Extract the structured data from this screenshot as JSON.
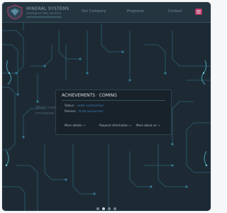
{
  "header": {
    "brand_title": "MINERAL SYSTEMS",
    "brand_subtitle": "Geological data services",
    "nav": [
      "Our Company",
      "Programs",
      "Contact"
    ],
    "menu_icon": "hamburger-icon",
    "logo_icon": "shield-logo-icon"
  },
  "card": {
    "title": "ACHIEVEMENTS · COMING",
    "rows": [
      {
        "label": "Status:",
        "value": "under construction"
      },
      {
        "label": "Release:",
        "value": "to be announced"
      }
    ],
    "links": [
      "More details →",
      "Request information →",
      "More about us →"
    ]
  },
  "background": {
    "ghost_lines": [
      "Where research meets",
      "innovation"
    ]
  },
  "pager": {
    "count": 4,
    "active_index": 1
  },
  "colors": {
    "background": "#1d2a34",
    "circuit": "#2f6f86",
    "accent": "#b33a67",
    "link": "#3f7fb6"
  }
}
